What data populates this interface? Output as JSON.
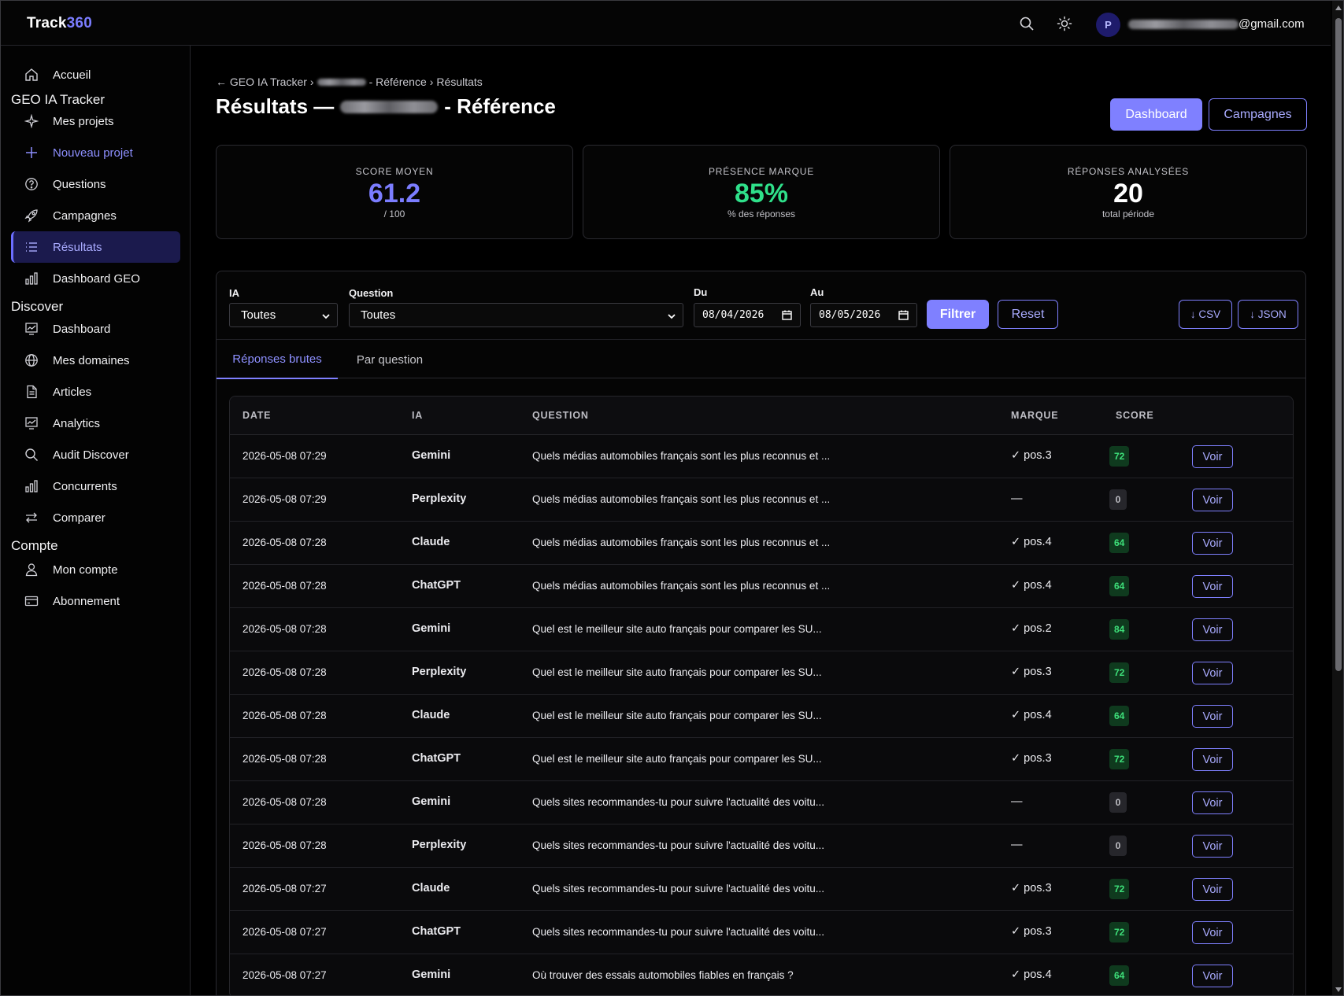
{
  "topbar": {
    "brand_part1": "Track",
    "brand_part2": "360",
    "avatar_initial": "P",
    "email_suffix": "@gmail.com"
  },
  "sidebar": {
    "home": "Accueil",
    "section_geo": "GEO IA Tracker",
    "geo_items": [
      "Mes projets",
      "Nouveau projet",
      "Questions",
      "Campagnes",
      "Résultats",
      "Dashboard GEO"
    ],
    "section_discover": "Discover",
    "discover_items": [
      "Dashboard",
      "Mes domaines",
      "Articles",
      "Analytics",
      "Audit Discover",
      "Concurrents",
      "Comparer"
    ],
    "section_account": "Compte",
    "account_items": [
      "Mon compte",
      "Abonnement"
    ],
    "active_item": "Résultats"
  },
  "header": {
    "breadcrumb_back": "← GEO IA Tracker",
    "breadcrumb_sep": "›",
    "breadcrumb_project_suffix": "- Référence",
    "breadcrumb_current": "Résultats",
    "title_prefix": "Résultats —",
    "title_suffix": "- Référence",
    "dashboard_button": "Dashboard",
    "campaigns_button": "Campagnes"
  },
  "stats": [
    {
      "label": "SCORE MOYEN",
      "value": "61.2",
      "sub": "/ 100",
      "color": "#7b7dff"
    },
    {
      "label": "PRÉSENCE MARQUE",
      "value": "85%",
      "sub": "% des réponses",
      "color": "#2fe08a"
    },
    {
      "label": "RÉPONSES ANALYSÉES",
      "value": "20",
      "sub": "total période",
      "color": "#ffffff"
    }
  ],
  "filters": {
    "ia_label": "IA",
    "ia_value": "Toutes",
    "question_label": "Question",
    "question_value": "Toutes",
    "from_label": "Du",
    "from_value": "08/04/2026",
    "to_label": "Au",
    "to_value": "08/05/2026",
    "filter_button": "Filtrer",
    "reset_button": "Reset",
    "csv_button": "↓ CSV",
    "json_button": "↓ JSON"
  },
  "tabs": [
    "Réponses brutes",
    "Par question"
  ],
  "table": {
    "columns": [
      "DATE",
      "IA",
      "QUESTION",
      "MARQUE",
      "SCORE"
    ],
    "action_label": "Voir",
    "rows": [
      {
        "date": "2026-05-08 07:29",
        "ia": "Gemini",
        "question": "Quels médias automobiles français sont les plus reconnus et ...",
        "brand": "✓ pos.3",
        "score": "72"
      },
      {
        "date": "2026-05-08 07:29",
        "ia": "Perplexity",
        "question": "Quels médias automobiles français sont les plus reconnus et ...",
        "brand": "—",
        "score": "0"
      },
      {
        "date": "2026-05-08 07:28",
        "ia": "Claude",
        "question": "Quels médias automobiles français sont les plus reconnus et ...",
        "brand": "✓ pos.4",
        "score": "64"
      },
      {
        "date": "2026-05-08 07:28",
        "ia": "ChatGPT",
        "question": "Quels médias automobiles français sont les plus reconnus et ...",
        "brand": "✓ pos.4",
        "score": "64"
      },
      {
        "date": "2026-05-08 07:28",
        "ia": "Gemini",
        "question": "Quel est le meilleur site auto français pour comparer les SU...",
        "brand": "✓ pos.2",
        "score": "84"
      },
      {
        "date": "2026-05-08 07:28",
        "ia": "Perplexity",
        "question": "Quel est le meilleur site auto français pour comparer les SU...",
        "brand": "✓ pos.3",
        "score": "72"
      },
      {
        "date": "2026-05-08 07:28",
        "ia": "Claude",
        "question": "Quel est le meilleur site auto français pour comparer les SU...",
        "brand": "✓ pos.4",
        "score": "64"
      },
      {
        "date": "2026-05-08 07:28",
        "ia": "ChatGPT",
        "question": "Quel est le meilleur site auto français pour comparer les SU...",
        "brand": "✓ pos.3",
        "score": "72"
      },
      {
        "date": "2026-05-08 07:28",
        "ia": "Gemini",
        "question": "Quels sites recommandes-tu pour suivre l'actualité des voitu...",
        "brand": "—",
        "score": "0"
      },
      {
        "date": "2026-05-08 07:28",
        "ia": "Perplexity",
        "question": "Quels sites recommandes-tu pour suivre l'actualité des voitu...",
        "brand": "—",
        "score": "0"
      },
      {
        "date": "2026-05-08 07:27",
        "ia": "Claude",
        "question": "Quels sites recommandes-tu pour suivre l'actualité des voitu...",
        "brand": "✓ pos.3",
        "score": "72"
      },
      {
        "date": "2026-05-08 07:27",
        "ia": "ChatGPT",
        "question": "Quels sites recommandes-tu pour suivre l'actualité des voitu...",
        "brand": "✓ pos.3",
        "score": "72"
      },
      {
        "date": "2026-05-08 07:27",
        "ia": "Gemini",
        "question": "Où trouver des essais automobiles fiables en français ?",
        "brand": "✓ pos.4",
        "score": "64"
      }
    ]
  }
}
